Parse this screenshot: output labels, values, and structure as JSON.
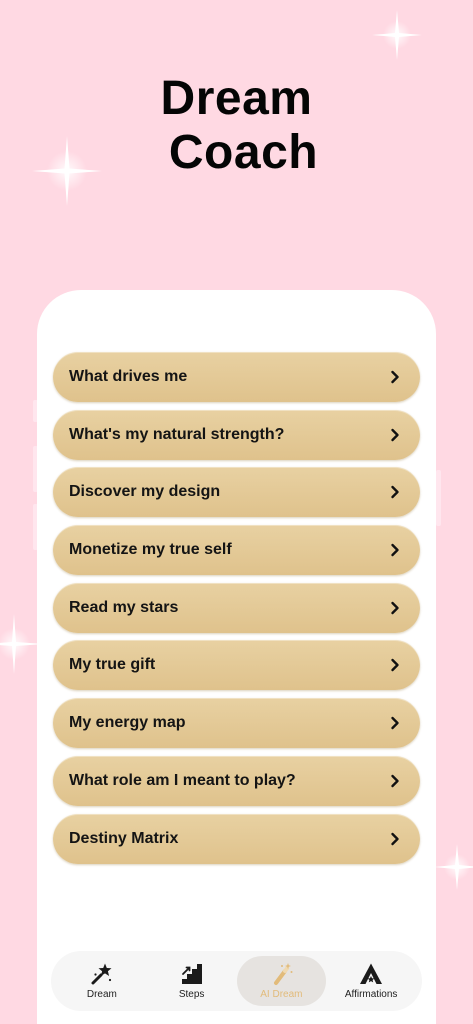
{
  "app": {
    "title_line1": "Dream",
    "title_line2": "Coach"
  },
  "menu": {
    "items": [
      {
        "label": "What drives me"
      },
      {
        "label": "What's my natural strength?"
      },
      {
        "label": "Discover my design"
      },
      {
        "label": "Monetize my true self"
      },
      {
        "label": "Read my stars"
      },
      {
        "label": "My true gift"
      },
      {
        "label": "My energy map"
      },
      {
        "label": "What role am I meant to play?"
      },
      {
        "label": "Destiny Matrix"
      }
    ],
    "chevron_icon": "chevron-right-icon"
  },
  "tabbar": {
    "tabs": [
      {
        "label": "Dream",
        "icon": "star-wand-icon",
        "active": false
      },
      {
        "label": "Steps",
        "icon": "stairs-icon",
        "active": false
      },
      {
        "label": "AI Dream",
        "icon": "magic-wand-icon",
        "active": true
      },
      {
        "label": "Affirmations",
        "icon": "triangle-star-icon",
        "active": false
      }
    ]
  },
  "colors": {
    "background": "#ffd9e3",
    "button_gold": "#e3c995",
    "active_tab_text": "#e2bb7a"
  }
}
